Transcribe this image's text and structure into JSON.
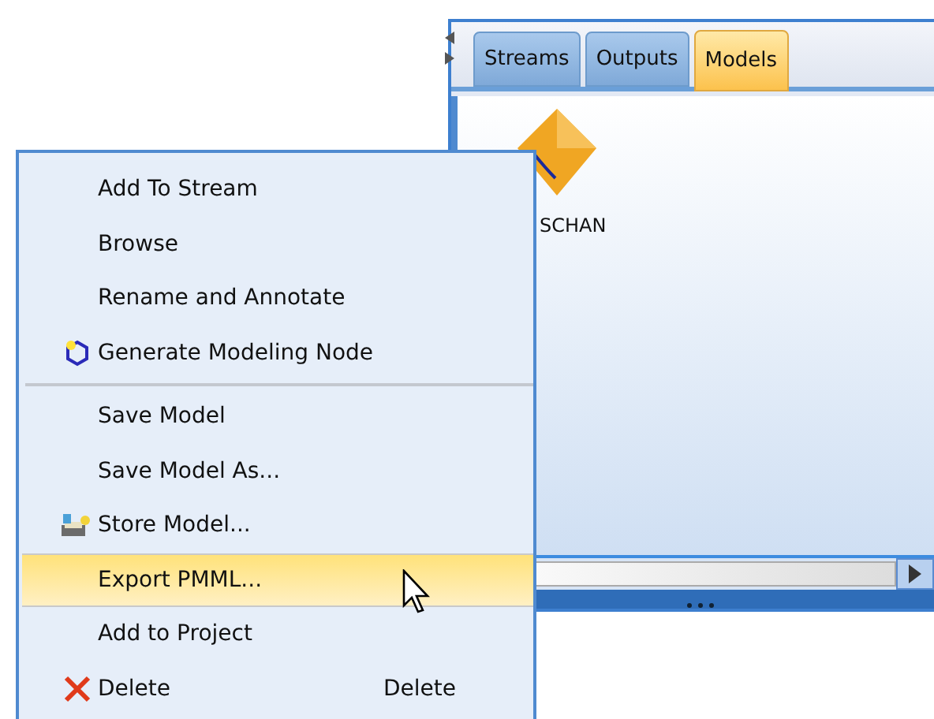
{
  "manager": {
    "tabs": [
      {
        "label": "Streams",
        "selected": false
      },
      {
        "label": "Outputs",
        "selected": false
      },
      {
        "label": "Models",
        "selected": true
      }
    ],
    "node": {
      "label": "SCHAN"
    }
  },
  "context_menu": {
    "items": [
      {
        "kind": "plain",
        "label": "Add To Stream",
        "highlighted": false
      },
      {
        "kind": "plain",
        "label": "Browse",
        "highlighted": false
      },
      {
        "kind": "plain",
        "label": "Rename and Annotate",
        "highlighted": false
      },
      {
        "kind": "generate",
        "label": "Generate Modeling Node",
        "highlighted": false
      },
      {
        "kind": "separator"
      },
      {
        "kind": "plain",
        "label": "Save Model",
        "highlighted": false
      },
      {
        "kind": "plain",
        "label": "Save Model As...",
        "highlighted": false
      },
      {
        "kind": "store",
        "label": "Store Model...",
        "highlighted": false
      },
      {
        "kind": "plain",
        "label": "Export PMML...",
        "highlighted": true
      },
      {
        "kind": "plain",
        "label": "Add to Project",
        "highlighted": false
      },
      {
        "kind": "delete",
        "label": "Delete",
        "shortcut": "Delete",
        "highlighted": false
      }
    ]
  }
}
